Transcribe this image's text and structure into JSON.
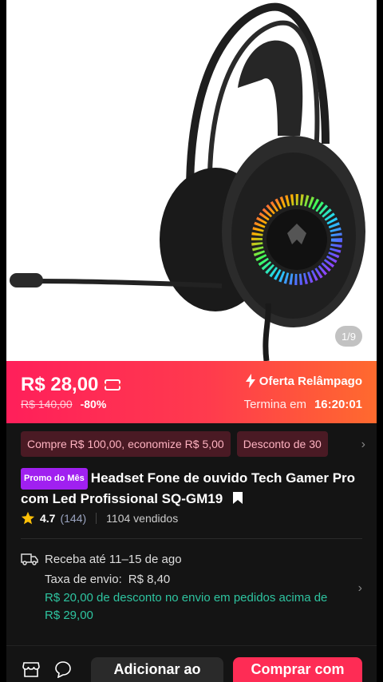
{
  "gallery": {
    "counter": "1/9",
    "image_icon": "headset-product-icon"
  },
  "price": {
    "current": "R$ 28,00",
    "original": "R$ 140,00",
    "discount": "-80%",
    "coupon_icon": "ticket-icon",
    "flash_label": "Oferta Relâmpago",
    "ends_label": "Termina em",
    "ends_time": "16:20:01",
    "colors": {
      "banner_start": "#ff1f5a",
      "banner_end": "#ff6a2e"
    }
  },
  "coupons": [
    "Compre R$ 100,00, economize R$ 5,00",
    "Desconto de 30"
  ],
  "product": {
    "badge": "Promo do Mês",
    "title": "Headset Fone de ouvido Tech Gamer Pro com Led Profissional SQ-GM19",
    "rating": "4.7",
    "reviews": "(144)",
    "sold": "1104 vendidos"
  },
  "shipping": {
    "delivery": "Receba até 11–15 de ago",
    "fee_label": "Taxa de envio:",
    "fee_value": "R$ 8,40",
    "promo": "R$ 20,00 de desconto no envio em pedidos acima de R$ 29,00",
    "promo_color": "#2ec4a0"
  },
  "actions": {
    "add_to_cart": "Adicionar ao",
    "buy": "Comprar com",
    "buy_color": "#fe2c55"
  }
}
